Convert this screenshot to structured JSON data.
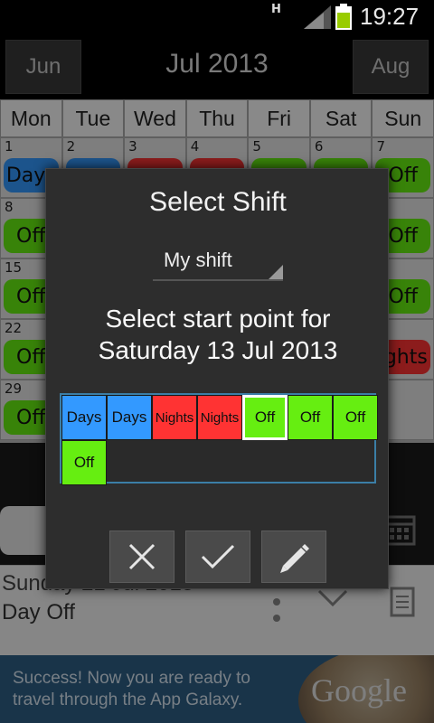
{
  "status_bar": {
    "network": "H",
    "time": "19:27",
    "battery_color": "#99cc00"
  },
  "header": {
    "prev_label": "Jun",
    "title": "Jul 2013",
    "next_label": "Aug"
  },
  "calendar": {
    "weekdays": [
      "Mon",
      "Tue",
      "Wed",
      "Thu",
      "Fri",
      "Sat",
      "Sun"
    ],
    "weeks": [
      [
        {
          "num": "1",
          "shift": "Days",
          "kind": "day-shift"
        },
        {
          "num": "2",
          "shift": "",
          "kind": "day-shift"
        },
        {
          "num": "3",
          "shift": "",
          "kind": "night-shift"
        },
        {
          "num": "4",
          "shift": "",
          "kind": "night-shift"
        },
        {
          "num": "5",
          "shift": "",
          "kind": "off-shift"
        },
        {
          "num": "6",
          "shift": "",
          "kind": "off-shift"
        },
        {
          "num": "7",
          "shift": "Off",
          "kind": "off-shift"
        }
      ],
      [
        {
          "num": "8",
          "shift": "Off",
          "kind": "off-shift"
        },
        {
          "num": "",
          "shift": "",
          "kind": ""
        },
        {
          "num": "",
          "shift": "",
          "kind": ""
        },
        {
          "num": "",
          "shift": "",
          "kind": ""
        },
        {
          "num": "",
          "shift": "",
          "kind": ""
        },
        {
          "num": "",
          "shift": "",
          "kind": ""
        },
        {
          "num": "4",
          "shift": "Off",
          "kind": "off-shift"
        }
      ],
      [
        {
          "num": "15",
          "shift": "Off",
          "kind": "off-shift"
        },
        {
          "num": "",
          "shift": "",
          "kind": ""
        },
        {
          "num": "",
          "shift": "",
          "kind": ""
        },
        {
          "num": "",
          "shift": "",
          "kind": ""
        },
        {
          "num": "",
          "shift": "",
          "kind": ""
        },
        {
          "num": "",
          "shift": "",
          "kind": ""
        },
        {
          "num": "",
          "shift": "Off",
          "kind": "off-shift"
        }
      ],
      [
        {
          "num": "22",
          "shift": "Off",
          "kind": "off-shift"
        },
        {
          "num": "",
          "shift": "",
          "kind": ""
        },
        {
          "num": "",
          "shift": "",
          "kind": ""
        },
        {
          "num": "",
          "shift": "",
          "kind": ""
        },
        {
          "num": "",
          "shift": "",
          "kind": ""
        },
        {
          "num": "",
          "shift": "",
          "kind": ""
        },
        {
          "num": "8",
          "shift": "ights",
          "kind": "night-shift"
        }
      ],
      [
        {
          "num": "29",
          "shift": "Off",
          "kind": "off-shift"
        },
        {
          "num": "",
          "shift": "",
          "kind": ""
        },
        {
          "num": "",
          "shift": "",
          "kind": ""
        },
        {
          "num": "",
          "shift": "",
          "kind": ""
        },
        {
          "num": "",
          "shift": "",
          "kind": ""
        },
        {
          "num": "",
          "shift": "",
          "kind": ""
        },
        {
          "num": "",
          "shift": "",
          "kind": ""
        }
      ]
    ]
  },
  "detail": {
    "line1": "Sunday 21 Jul 2013",
    "line2": "Day Off"
  },
  "ad": {
    "line1": "Success! Now you are ready to",
    "line2": "travel through the App Galaxy.",
    "brand": "Google"
  },
  "dialog": {
    "title": "Select Shift",
    "spinner_value": "My shift",
    "prompt_line1": "Select start point for",
    "prompt_line2": "Saturday 13 Jul 2013",
    "shifts": [
      {
        "label": "Days",
        "kind": "days",
        "selected": false
      },
      {
        "label": "Days",
        "kind": "days",
        "selected": false
      },
      {
        "label": "Nights",
        "kind": "nights",
        "selected": false
      },
      {
        "label": "Nights",
        "kind": "nights",
        "selected": false
      },
      {
        "label": "Off",
        "kind": "off",
        "selected": true
      },
      {
        "label": "Off",
        "kind": "off",
        "selected": false
      },
      {
        "label": "Off",
        "kind": "off",
        "selected": false
      },
      {
        "label": "Off",
        "kind": "off",
        "selected": false
      }
    ],
    "buttons": {
      "cancel_icon": "close-icon",
      "ok_icon": "check-icon",
      "edit_icon": "pencil-icon"
    }
  },
  "colors": {
    "days": "#3399ff",
    "nights": "#ff3333",
    "off": "#66ee11",
    "dialog_bg": "#2d2d2d",
    "grid_border": "#3b7ea6"
  }
}
